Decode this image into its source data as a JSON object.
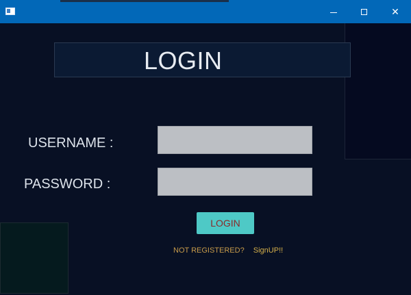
{
  "titlebar": {
    "app_icon": "window-app-icon",
    "minimize_icon": "minimize-icon",
    "maximize_icon": "maximize-icon",
    "close_icon": "close-icon",
    "close_glyph": "✕",
    "color": "#0268b8"
  },
  "login_form": {
    "heading": "LOGIN",
    "username_label": "USERNAME :",
    "password_label": "PASSWORD :",
    "username_value": "",
    "password_value": "",
    "login_button": "LOGIN",
    "signup_prompt": "NOT REGISTERED?",
    "signup_link": "SignUP!!"
  },
  "colors": {
    "background": "#081024",
    "button_bg": "#4ec9c6",
    "button_text": "#8a2a2a",
    "signup_text": "#c79b4a",
    "input_bg": "#bcbfc4"
  }
}
